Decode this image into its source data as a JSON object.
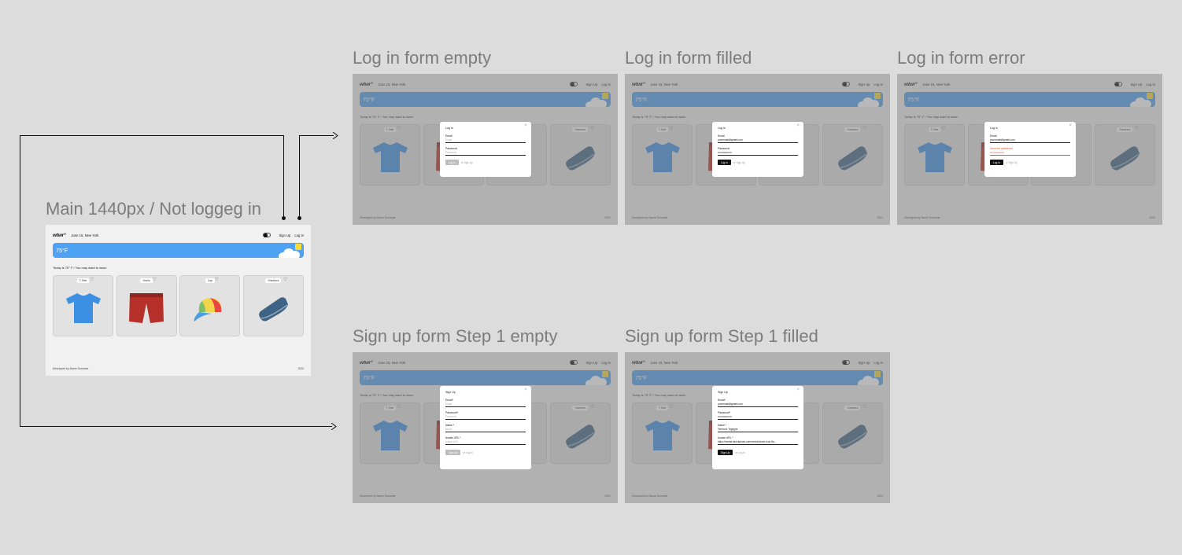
{
  "frames": {
    "main": "Main 1440px / Not loggeg in",
    "login_empty": "Log in form empty",
    "login_filled": "Log in form filled",
    "login_error": "Log in form error",
    "signup_empty": "Sign up form Step 1 empty",
    "signup_filled": "Sign up form Step 1 filled"
  },
  "app": {
    "logo": "wtwr°",
    "date": "June 15, New York",
    "signup": "Sign Up",
    "login": "Log In",
    "temp": "75°F",
    "today": "Today is 75° F / You may want to wear:",
    "footer_left": "Developed by Name Surname",
    "footer_right": "2022",
    "colors": {
      "banner": "#4ea2f3",
      "sun": "#f7dc3b",
      "error": "#e2552a",
      "primary_button": "#111111"
    }
  },
  "cards": [
    {
      "label": "T-Shirt",
      "icon": "tshirt-icon"
    },
    {
      "label": "Shorts",
      "icon": "shorts-icon"
    },
    {
      "label": "Cap",
      "icon": "cap-icon"
    },
    {
      "label": "Sneakers",
      "icon": "sneakers-icon"
    }
  ],
  "login": {
    "title": "Log in",
    "email_label": "Email",
    "email_placeholder": "Email",
    "password_label": "Password",
    "password_placeholder": "Password",
    "filled_email": "youremail@gmail.com",
    "filled_password": "••••••••••••••••",
    "error_label": "Incorrect password",
    "submit": "Log In",
    "alt": "or Sign Up"
  },
  "signup": {
    "title": "Sign Up",
    "email_label": "Email*",
    "email_placeholder": "Email",
    "password_label": "Password*",
    "password_placeholder": "Password",
    "name_label": "Name *",
    "name_placeholder": "Name",
    "avatar_label": "Avatar URL *",
    "avatar_placeholder": "Avatar URL",
    "filled_email": "youremail@gmail.com",
    "filled_password": "••••••••••••••••",
    "filled_name": "Terrence Tegegne",
    "filled_avatar": "https://media.istockphoto.com/vectors/user-icon-fla...",
    "submit": "Sign Up",
    "alt": "or Log In"
  }
}
